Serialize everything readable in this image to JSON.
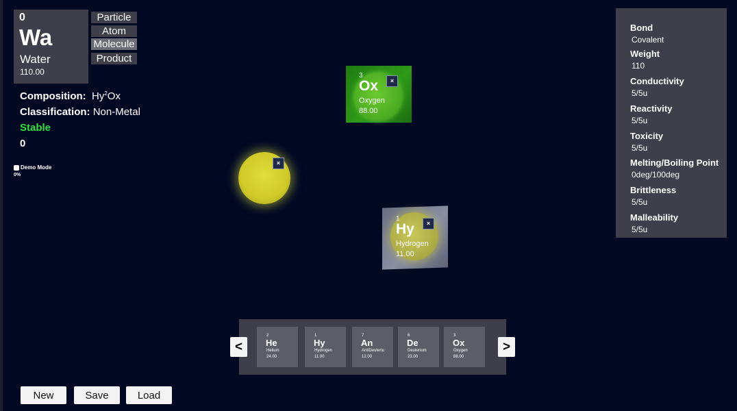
{
  "current": {
    "number": "0",
    "symbol": "Wa",
    "name": "Water",
    "weight": "110.00"
  },
  "modes": [
    "Particle",
    "Atom",
    "Molecule",
    "Product"
  ],
  "active_mode": "Molecule",
  "info": {
    "composition_label": "Composition:",
    "composition_prefix": "Hy",
    "composition_sup": "2",
    "composition_suffix": "Ox",
    "classification_label": "Classification:",
    "classification_value": "Non-Metal",
    "status": "Stable",
    "counter": "0"
  },
  "demo": {
    "label": "Demo Mode",
    "progress": "0%"
  },
  "properties": [
    {
      "label": "Bond",
      "value": "Covalent"
    },
    {
      "label": "Weight",
      "value": "110"
    },
    {
      "label": "Conductivity",
      "value": "5/5u"
    },
    {
      "label": "Reactivity",
      "value": "5/5u"
    },
    {
      "label": "Toxicity",
      "value": "5/5u"
    },
    {
      "label": "Melting/Boiling Point",
      "value": "0deg/100deg"
    },
    {
      "label": "Brittleness",
      "value": "5/5u"
    },
    {
      "label": "Malleability",
      "value": "5/5u"
    }
  ],
  "scene": {
    "oxygen": {
      "number": "3",
      "symbol": "Ox",
      "name": "Oxygen",
      "weight": "88.00",
      "color": "#3b9a16"
    },
    "hydrogen": {
      "number": "1",
      "symbol": "Hy",
      "name": "Hydrogen",
      "weight": "11.00",
      "color": "#c9c234"
    },
    "close_glyph": "×"
  },
  "palette": [
    {
      "number": "2",
      "symbol": "He",
      "name": "Helium",
      "weight": "24.00"
    },
    {
      "number": "1",
      "symbol": "Hy",
      "name": "Hydrogen",
      "weight": "11.00"
    },
    {
      "number": "7",
      "symbol": "An",
      "name": "AntiDeuteriu",
      "weight": "12.00"
    },
    {
      "number": "6",
      "symbol": "De",
      "name": "Deuterium",
      "weight": "23.00"
    },
    {
      "number": "3",
      "symbol": "Ox",
      "name": "Oxygen",
      "weight": "88.00"
    }
  ],
  "nav": {
    "prev": "<",
    "next": ">"
  },
  "buttons": {
    "new": "New",
    "save": "Save",
    "load": "Load"
  }
}
